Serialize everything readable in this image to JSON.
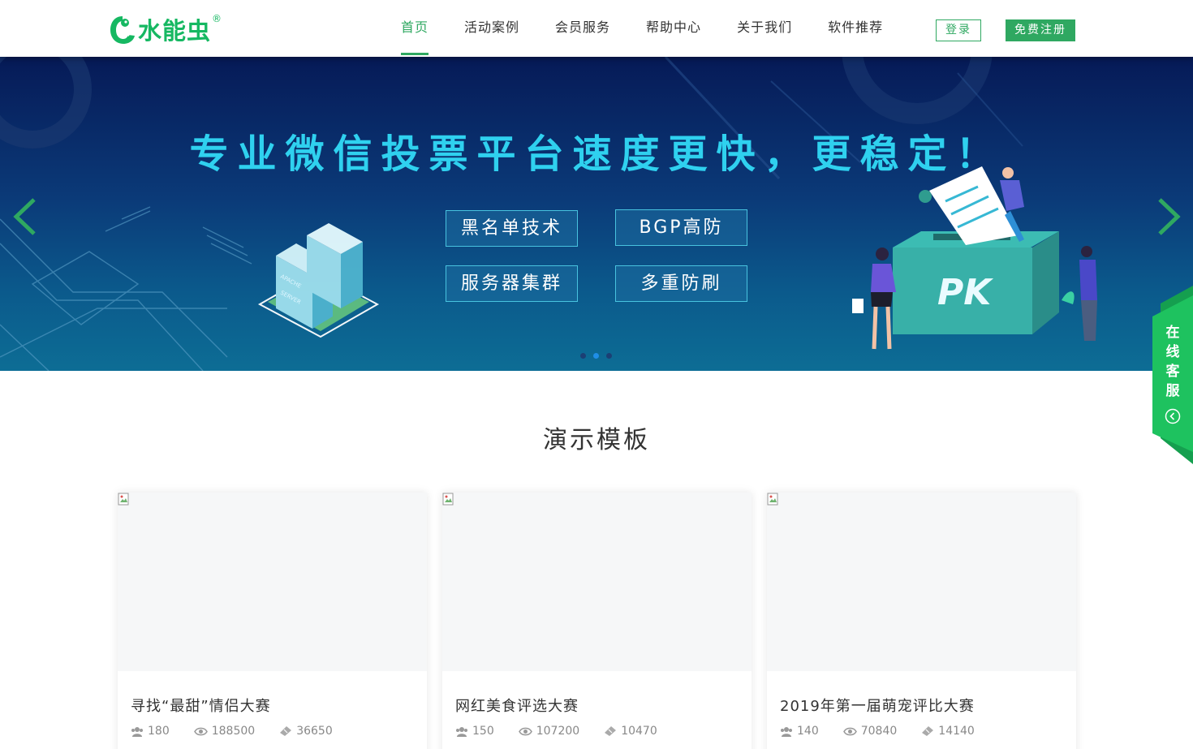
{
  "header": {
    "brand": "水能虫",
    "brand_mark": "®",
    "nav": [
      {
        "label": "首页",
        "active": true
      },
      {
        "label": "活动案例",
        "active": false
      },
      {
        "label": "会员服务",
        "active": false
      },
      {
        "label": "帮助中心",
        "active": false
      },
      {
        "label": "关于我们",
        "active": false
      },
      {
        "label": "软件推荐",
        "active": false
      }
    ],
    "login_label": "登录",
    "register_label": "免费注册"
  },
  "banner": {
    "title": "专业微信投票平台速度更快，更稳定！",
    "features": [
      "黑名单技术",
      "BGP高防",
      "服务器集群",
      "多重防刷"
    ],
    "box_label": "PK",
    "server_label_1": "APACHE",
    "server_label_2": "SERVER",
    "slide_count": 3,
    "active_slide": 2
  },
  "section": {
    "title": "演示模板"
  },
  "cards": [
    {
      "title": "寻找“最甜”情侣大赛",
      "participants": "180",
      "views": "188500",
      "votes": "36650"
    },
    {
      "title": "网红美食评选大赛",
      "participants": "150",
      "views": "107200",
      "votes": "10470"
    },
    {
      "title": "2019年第一届萌宠评比大赛",
      "participants": "140",
      "views": "70840",
      "votes": "14140"
    }
  ],
  "service": {
    "label": [
      "在",
      "线",
      "客",
      "服"
    ]
  },
  "colors": {
    "brand_green": "#2fa861",
    "logo_green": "#16b862",
    "banner_title": "#2fd1ef",
    "banner_dark": "#061a57"
  },
  "icons": {
    "prev": "chevron-left-icon",
    "next": "chevron-right-icon",
    "participants": "users-icon",
    "views": "eye-icon",
    "votes": "ticket-icon",
    "service_toggle": "chevron-left-circle-icon"
  }
}
